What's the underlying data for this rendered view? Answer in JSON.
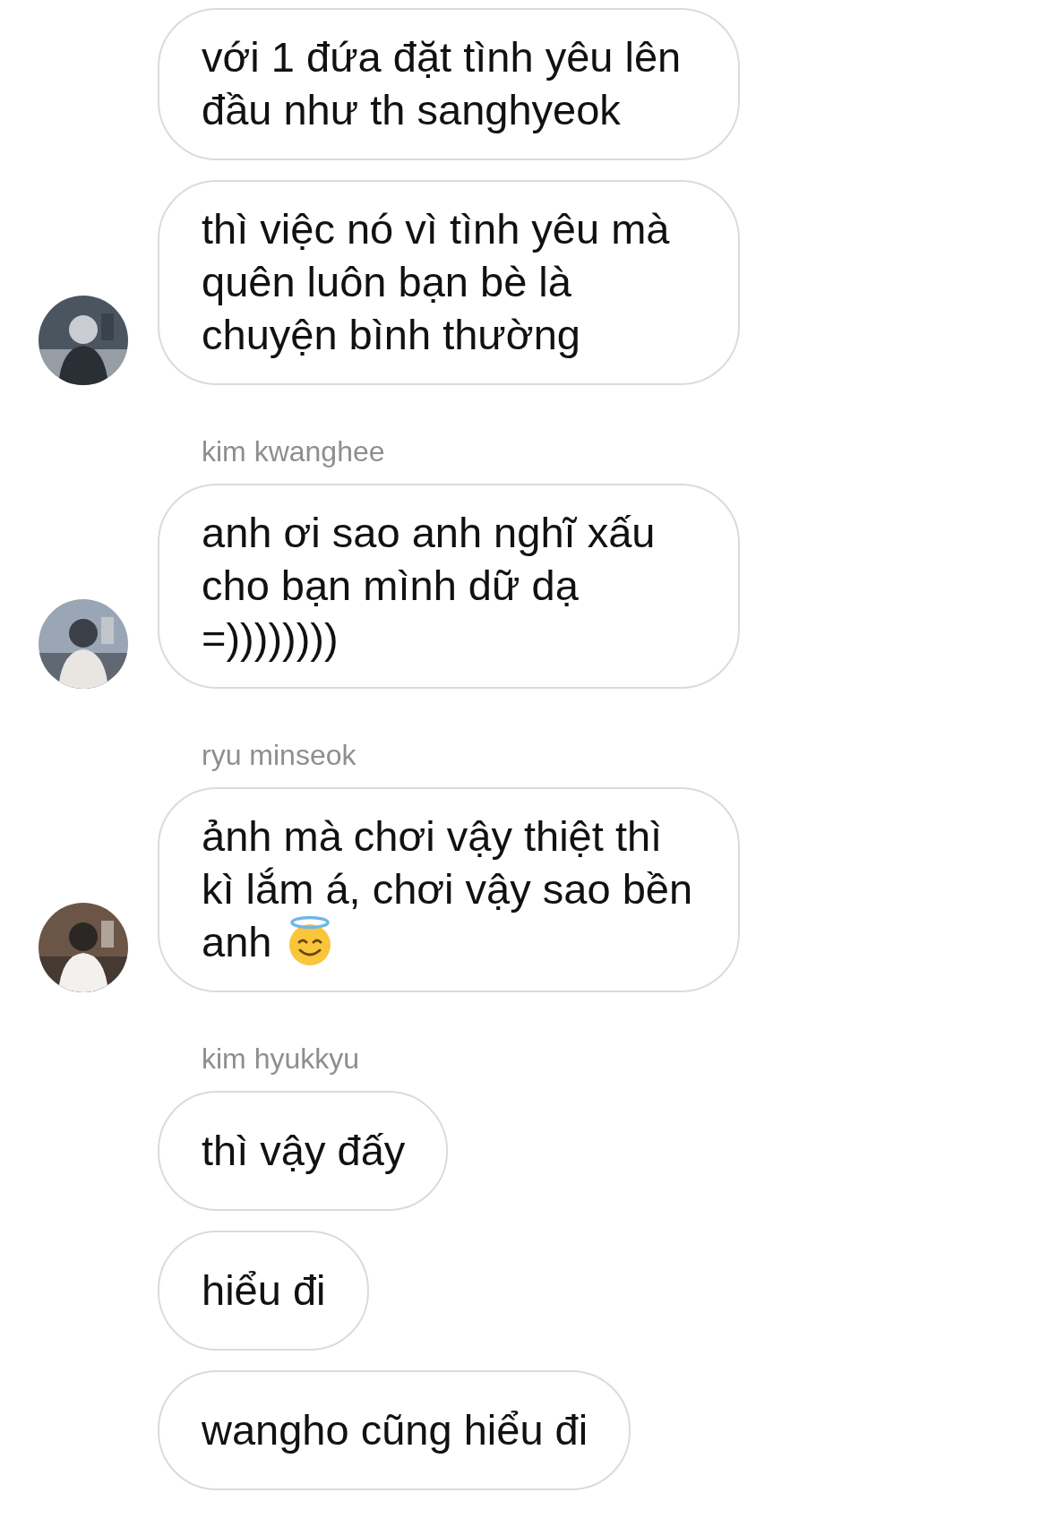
{
  "groups": [
    {
      "avatar": {
        "kind": "picture"
      },
      "messages": [
        {
          "kind": "text",
          "text": "với 1 đứa đặt tình yêu lên đầu như th sanghyeok"
        },
        {
          "kind": "text",
          "text": "thì việc nó vì tình yêu mà quên luôn bạn bè là chuyện bình thường"
        }
      ]
    },
    {
      "sender": "kim kwanghee",
      "avatar": {
        "kind": "picture"
      },
      "messages": [
        {
          "kind": "text",
          "text": "anh ơi sao anh nghĩ xấu cho bạn mình dữ dạ =))))))))"
        }
      ]
    },
    {
      "sender": "ryu minseok",
      "avatar": {
        "kind": "picture"
      },
      "messages": [
        {
          "kind": "text_with_icon",
          "text": "ảnh mà chơi vậy thiệt thì kì lắm á, chơi vậy sao bền anh"
        }
      ]
    },
    {
      "sender": "kim hyukkyu",
      "messages": [
        {
          "kind": "text",
          "text": "thì vậy đấy"
        },
        {
          "kind": "text",
          "text": "hiểu đi"
        },
        {
          "kind": "text",
          "text": "wangho cũng hiểu đi"
        }
      ]
    }
  ]
}
